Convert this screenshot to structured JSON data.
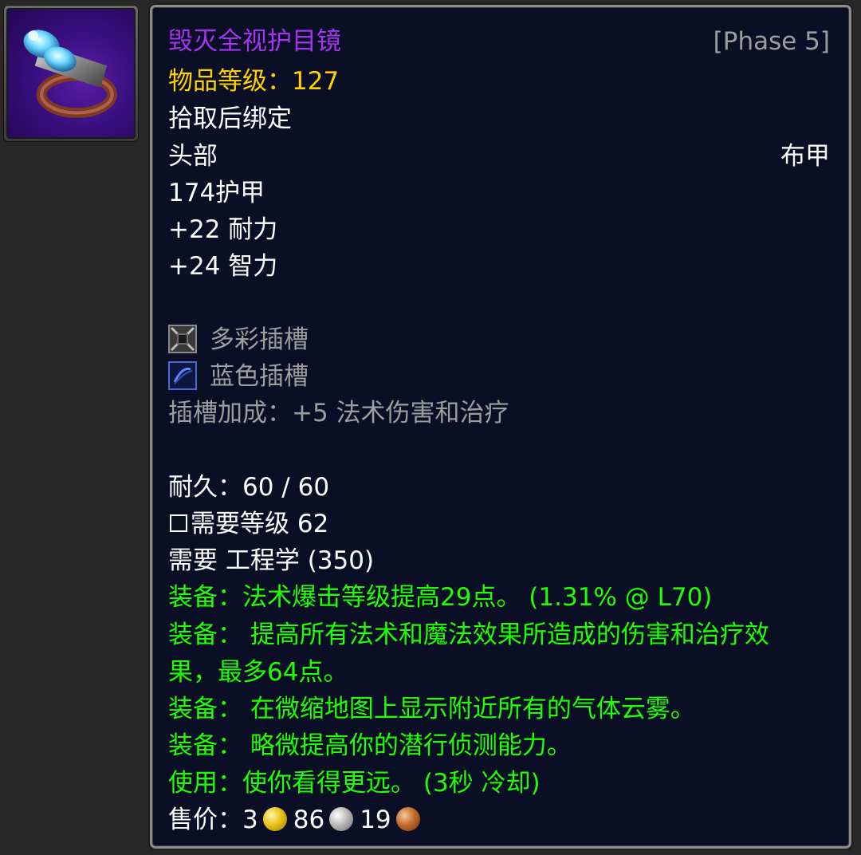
{
  "icon": {
    "name": "goggles-icon"
  },
  "item": {
    "name": "毁灭全视护目镜",
    "phase": "[Phase 5]",
    "item_level_label": "物品等级：",
    "item_level_value": "127",
    "bind": "拾取后绑定",
    "slot": "头部",
    "armor_type": "布甲",
    "armor": "174护甲",
    "stamina": "+22 耐力",
    "intellect": "+24 智力"
  },
  "sockets": {
    "meta": "多彩插槽",
    "blue": "蓝色插槽",
    "bonus": "插槽加成：+5 法术伤害和治疗"
  },
  "requirements": {
    "durability": "耐久：60 / 60",
    "level": "需要等级 62",
    "profession": "需要 工程学 (350)"
  },
  "effects": {
    "equip_1": "装备：法术爆击等级提高29点。 (1.31% @ L70)",
    "equip_2_line1": "装备： 提高所有法术和魔法效果所造成的伤害和治疗效",
    "equip_2_line2": "果，最多64点。",
    "equip_3": "装备： 在微缩地图上显示附近所有的气体云雾。",
    "equip_4": "装备： 略微提高你的潜行侦测能力。",
    "use": "使用：使你看得更远。 (3秒 冷却)"
  },
  "sell_price": {
    "label": "售价：",
    "gold": "3",
    "silver": "86",
    "copper": "19"
  },
  "colors": {
    "epic": "#a335ee",
    "gold": "#ffd100",
    "green": "#1eff00",
    "gray": "#9d9d9d",
    "background": "#0b0f26"
  }
}
